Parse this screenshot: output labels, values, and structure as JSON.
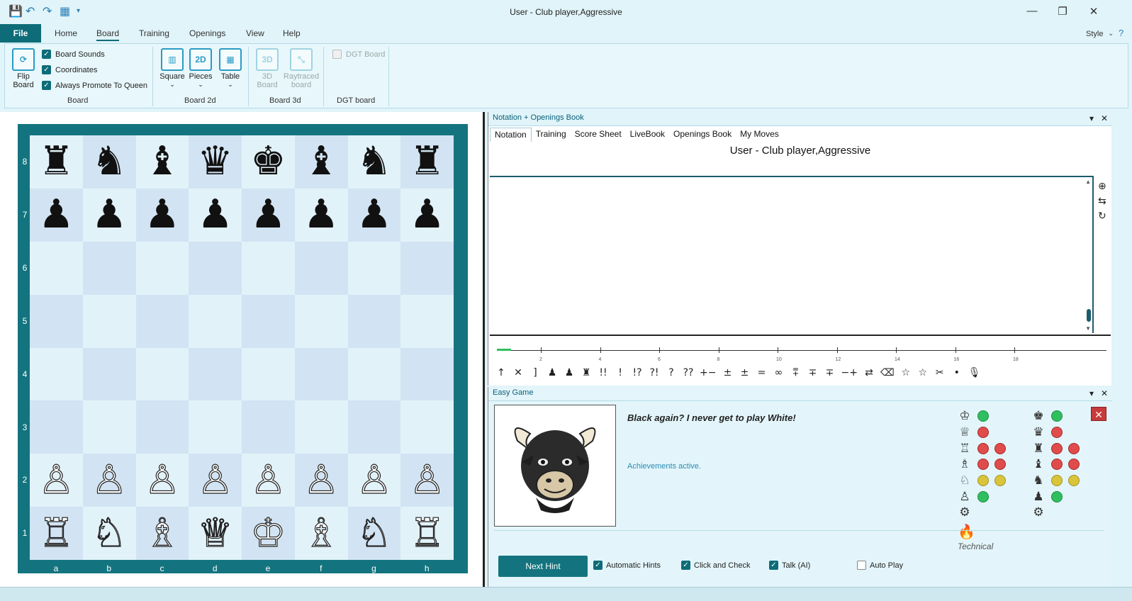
{
  "window": {
    "title": "User - Club player,Aggressive",
    "quick_access": [
      "save-icon",
      "undo-icon",
      "redo-icon",
      "layout-icon",
      "dropdown-icon"
    ],
    "controls": [
      "minimize",
      "restore",
      "close"
    ]
  },
  "ribbon_tabs": {
    "file": "File",
    "home": "Home",
    "board": "Board",
    "training": "Training",
    "openings": "Openings",
    "view": "View",
    "help": "Help",
    "style": "Style"
  },
  "ribbon": {
    "flip_board": "Flip\nBoard",
    "board_sounds": "Board Sounds",
    "coordinates": "Coordinates",
    "always_promote": "Always Promote To Queen",
    "group_board": "Board",
    "square": "Square",
    "pieces": "Pieces",
    "table": "Table",
    "group_board2d": "Board 2d",
    "board3d": "3D\nBoard",
    "raytraced": "Raytraced\nboard",
    "group_board3d": "Board 3d",
    "dgt_board": "DGT Board",
    "group_dgt": "DGT board",
    "icon_2d": "2D",
    "icon_3d": "3D"
  },
  "board": {
    "ranks": [
      "8",
      "7",
      "6",
      "5",
      "4",
      "3",
      "2",
      "1"
    ],
    "files": [
      "a",
      "b",
      "c",
      "d",
      "e",
      "f",
      "g",
      "h"
    ],
    "rows": [
      [
        "♜",
        "♞",
        "♝",
        "♛",
        "♚",
        "♝",
        "♞",
        "♜"
      ],
      [
        "♟",
        "♟",
        "♟",
        "♟",
        "♟",
        "♟",
        "♟",
        "♟"
      ],
      [
        "",
        "",
        "",
        "",
        "",
        "",
        "",
        ""
      ],
      [
        "",
        "",
        "",
        "",
        "",
        "",
        "",
        ""
      ],
      [
        "",
        "",
        "",
        "",
        "",
        "",
        "",
        ""
      ],
      [
        "",
        "",
        "",
        "",
        "",
        "",
        "",
        ""
      ],
      [
        "♙",
        "♙",
        "♙",
        "♙",
        "♙",
        "♙",
        "♙",
        "♙"
      ],
      [
        "♖",
        "♘",
        "♗",
        "♕",
        "♔",
        "♗",
        "♘",
        "♖"
      ]
    ]
  },
  "notation": {
    "pane_title": "Notation + Openings Book",
    "tabs": [
      "Notation",
      "Training",
      "Score Sheet",
      "LiveBook",
      "Openings Book",
      "My Moves"
    ],
    "game_header": "User - Club player,Aggressive",
    "eval_ticks": [
      "2",
      "4",
      "6",
      "8",
      "10",
      "12",
      "14",
      "16",
      "18"
    ],
    "annotations": [
      "↑",
      "✕",
      "]",
      "♟",
      "♟",
      "♜",
      "!!",
      "!",
      "!?",
      "?!",
      "?",
      "??",
      "+−",
      "±",
      "±",
      "=",
      "∞",
      "⩱",
      "∓",
      "∓",
      "−+",
      "⇄",
      "⌫",
      "☆",
      "☆",
      "✂",
      "•",
      "🎙"
    ]
  },
  "easy_game": {
    "pane_title": "Easy Game",
    "speech": "Black again? I never get to play White!",
    "achievements": "Achievements active.",
    "technical": "Technical",
    "next_hint": "Next Hint",
    "automatic_hints": "Automatic Hints",
    "click_and_check": "Click and Check",
    "talk_ai": "Talk (AI)",
    "auto_play": "Auto Play",
    "white_stats": [
      {
        "piece": "♔",
        "dots": [
          "green"
        ]
      },
      {
        "piece": "♕",
        "dots": [
          "red"
        ]
      },
      {
        "piece": "♖",
        "dots": [
          "red",
          "red"
        ]
      },
      {
        "piece": "♗",
        "dots": [
          "red",
          "red"
        ]
      },
      {
        "piece": "♘",
        "dots": [
          "yellow",
          "yellow"
        ]
      },
      {
        "piece": "♙",
        "dots": [
          "green"
        ]
      },
      {
        "piece": "⚙",
        "dots": []
      }
    ],
    "black_stats": [
      {
        "piece": "♚",
        "dots": [
          "green"
        ]
      },
      {
        "piece": "♛",
        "dots": [
          "red"
        ]
      },
      {
        "piece": "♜",
        "dots": [
          "red",
          "red"
        ]
      },
      {
        "piece": "♝",
        "dots": [
          "red",
          "red"
        ]
      },
      {
        "piece": "♞",
        "dots": [
          "yellow",
          "yellow"
        ]
      },
      {
        "piece": "♟",
        "dots": [
          "green"
        ]
      },
      {
        "piece": "⚙",
        "dots": []
      }
    ]
  },
  "colors": {
    "accent": "#13747f",
    "file_tab": "#0e6c78",
    "light_square": "#e2f2f9",
    "dark_square": "#d2e4f3"
  }
}
